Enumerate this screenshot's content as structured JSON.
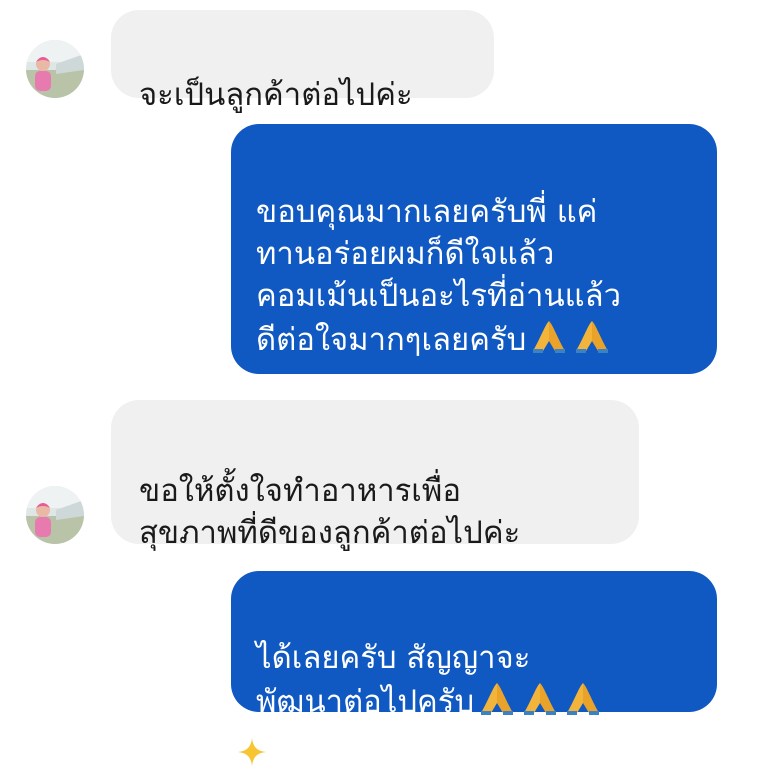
{
  "messages": [
    {
      "id": "m1",
      "side": "incoming",
      "text": "จะเป็นลูกค้าต่อไปค่ะ",
      "prayer_count": 0
    },
    {
      "id": "m2",
      "side": "outgoing",
      "text": "ขอบคุณมากเลยครับพี่ แค่\nทานอร่อยผมก็ดีใจแล้ว\nคอมเม้นเป็นอะไรที่อ่านแล้ว\nดีต่อใจมากๆเลยครับ",
      "prayer_count": 2
    },
    {
      "id": "m3",
      "side": "incoming",
      "text": "ขอให้ตั้งใจทำอาหารเพื่อ\nสุขภาพที่ดีของลูกค้าต่อไปค่ะ",
      "prayer_count": 0
    },
    {
      "id": "m4",
      "side": "outgoing",
      "text": "ได้เลยครับ สัญญาจะ\nพัฒนาต่อไปครับ",
      "prayer_count": 3
    }
  ],
  "colors": {
    "outgoing_bubble": "#1058c2",
    "incoming_bubble": "#f0f0f0",
    "sparkle": "#f7c531",
    "prayer_emoji": "#f2b43a"
  },
  "icons": {
    "avatar": "profile-photo-avatar",
    "prayer": "folded-hands-emoji",
    "sparkle": "sparkle-icon"
  }
}
